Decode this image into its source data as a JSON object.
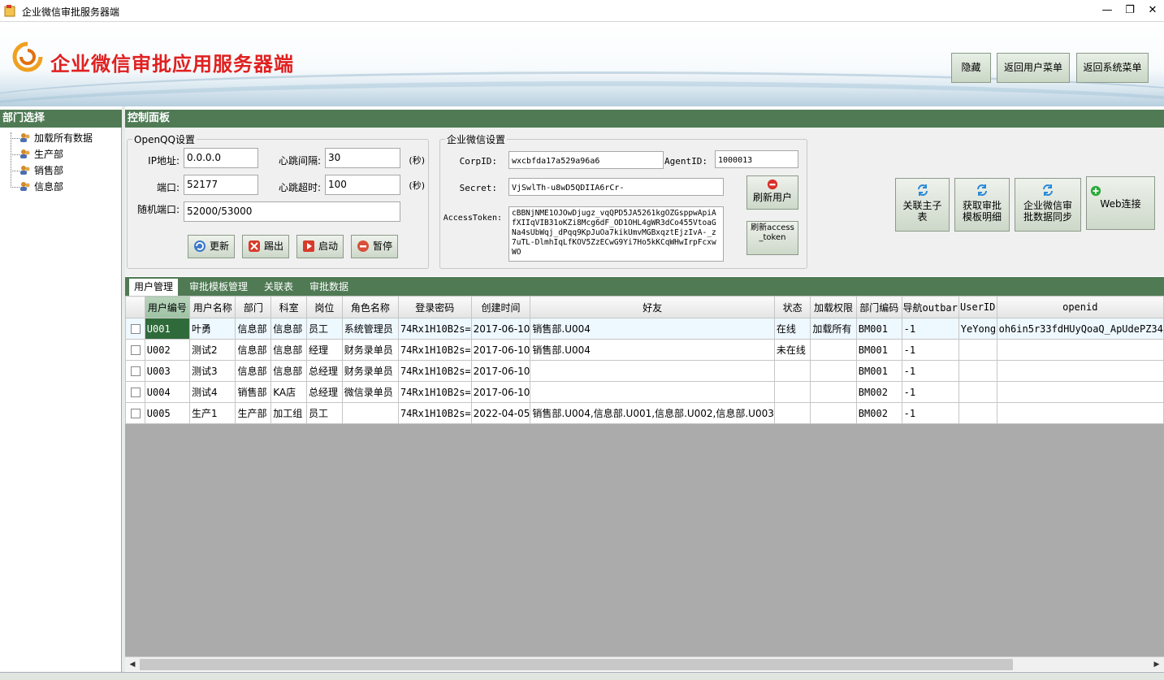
{
  "window": {
    "title": "企业微信审批服务器端",
    "minimize": "—",
    "maximize": "❐",
    "close": "✕"
  },
  "banner": {
    "brand": "企业微信审批应用服务器端",
    "buttons": {
      "hide": "隐藏",
      "back_user": "返回用户菜单",
      "back_system": "返回系统菜单"
    }
  },
  "left": {
    "header": "部门选择",
    "tree": [
      "加载所有数据",
      "生产部",
      "销售部",
      "信息部"
    ]
  },
  "control": {
    "header": "控制面板",
    "openqq": {
      "title": "OpenQQ设置",
      "ip_label": "IP地址:",
      "ip": "0.0.0.0",
      "port_label": "端口:",
      "port": "52177",
      "rand_label": "随机端口:",
      "rand": "52000/53000",
      "hb_interval_label": "心跳间隔:",
      "hb_interval": "30",
      "hb_timeout_label": "心跳超时:",
      "hb_timeout": "100",
      "sec1": "(秒)",
      "sec2": "(秒)",
      "btn_update": "更新",
      "btn_kick": "踢出",
      "btn_start": "启动",
      "btn_pause": "暂停"
    },
    "wechat": {
      "title": "企业微信设置",
      "corpid_label": "CorpID:",
      "corpid": "wxcbfda17a529a96a6",
      "agentid_label": "AgentID:",
      "agentid": "1000013",
      "secret_label": "Secret:",
      "secret": "VjSwlTh-u8wD5QDIIA6rCr-",
      "token_label": "AccessToken:",
      "token": "cBBNjNME1OJOwDjugz_vqQPD5JA5261kgOZGsppwApiAfXIIqVIB31oKZi8Mcg6dF_OD1OHL4gWR3dCo455VtoaGNa4sUbWqj_dPqq9KpJuOa7kikUmvMGBxqztEjzIvA-_z7uTL-DlmhIqLfKOV5ZzECwG9Yi7Ho5kKCqWHwIrpFcxwWO",
      "btn_refresh_user": "刷新用户",
      "btn_refresh_token": "刷新access_token"
    },
    "actions": {
      "link_main": "关联主子表",
      "get_template": "获取审批模板明细",
      "sync": "企业微信审批数据同步",
      "web": "Web连接"
    }
  },
  "tabs": [
    "用户管理",
    "审批模板管理",
    "关联表",
    "审批数据"
  ],
  "grid": {
    "columns": [
      "",
      "用户编号",
      "用户名称",
      "部门",
      "科室",
      "岗位",
      "角色名称",
      "登录密码",
      "创建时间",
      "好友",
      "状态",
      "加载权限",
      "部门编码",
      "导航outbar",
      "UserID",
      "openid"
    ],
    "rows": [
      [
        "",
        "U001",
        "叶勇",
        "信息部",
        "信息部",
        "员工",
        "系统管理员",
        "74Rx1H10B2s=",
        "2017-06-10",
        "销售部.U004",
        "在线",
        "加载所有",
        "BM001",
        "-1",
        "YeYong",
        "oh6in5r33fdHUyQoaQ_ApUdePZ34"
      ],
      [
        "",
        "U002",
        "测试2",
        "信息部",
        "信息部",
        "经理",
        "财务录单员",
        "74Rx1H10B2s=",
        "2017-06-10",
        "销售部.U004",
        "未在线",
        "",
        "BM001",
        "-1",
        "",
        ""
      ],
      [
        "",
        "U003",
        "测试3",
        "信息部",
        "信息部",
        "总经理",
        "财务录单员",
        "74Rx1H10B2s=",
        "2017-06-10",
        "",
        "",
        "",
        "BM001",
        "-1",
        "",
        ""
      ],
      [
        "",
        "U004",
        "测试4",
        "销售部",
        "KA店",
        "总经理",
        "微信录单员",
        "74Rx1H10B2s=",
        "2017-06-10",
        "",
        "",
        "",
        "BM002",
        "-1",
        "",
        ""
      ],
      [
        "",
        "U005",
        "生产1",
        "生产部",
        "加工组",
        "员工",
        "",
        "74Rx1H10B2s=",
        "2022-04-05",
        "销售部.U004,信息部.U001,信息部.U002,信息部.U003",
        "",
        "",
        "BM002",
        "-1",
        "",
        ""
      ]
    ]
  },
  "colors": {
    "accent": "#4f7a54",
    "brand": "#e02020",
    "selected": "#2f6b3a"
  }
}
